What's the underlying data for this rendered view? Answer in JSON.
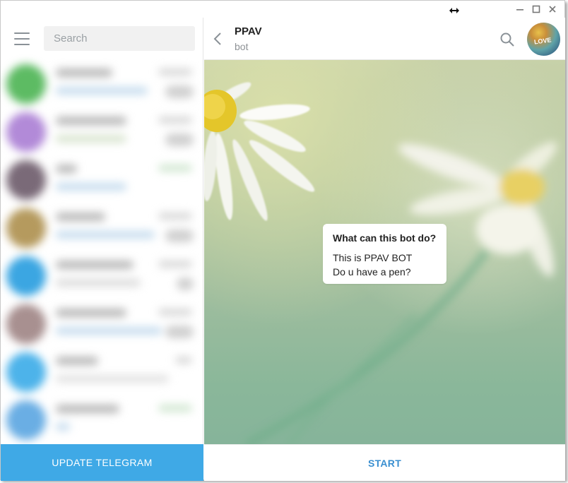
{
  "colors": {
    "accent": "#3fa9e6",
    "link": "#3a8fd0",
    "icon_gray": "#8a9197"
  },
  "sidebar": {
    "search_placeholder": "Search",
    "update_button_label": "UPDATE TELEGRAM"
  },
  "chat": {
    "peer_name": "PPAV",
    "peer_status": "bot",
    "avatar_text": "LOVE",
    "bot_info": {
      "title": "What can this bot do?",
      "lines": [
        "This is PPAV BOT",
        "Do u have a pen?"
      ]
    },
    "start_button_label": "START"
  },
  "icons": {
    "menu": "hamburger-menu-icon",
    "back": "chevron-left-icon",
    "search": "search-icon",
    "minimize": "minimize-icon",
    "maximize": "maximize-icon",
    "close": "close-icon",
    "resize": "resize-cursor-icon"
  }
}
